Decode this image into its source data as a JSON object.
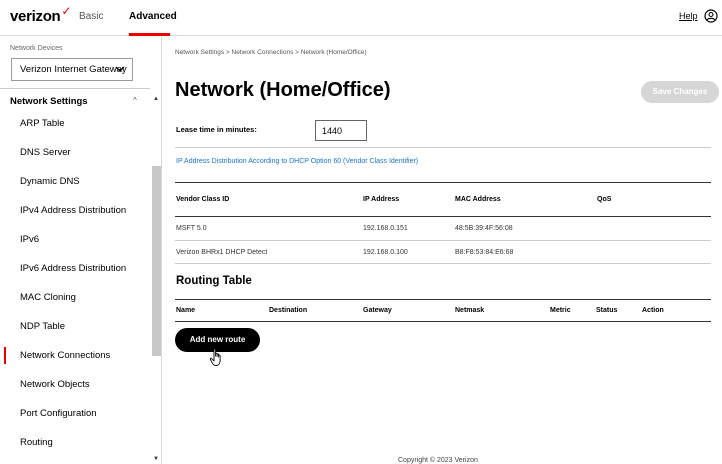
{
  "header": {
    "logo": "verizon",
    "logo_mark": "✓",
    "tabs": [
      {
        "label": "Basic"
      },
      {
        "label": "Advanced"
      }
    ],
    "help_label": "Help",
    "user_icon": "user-circle-icon",
    "accent_color": "#ee0000"
  },
  "sidebar": {
    "devices_label": "Network Devices",
    "device_selected": "Verizon Internet Gateway",
    "section_title": "Network Settings",
    "items": [
      {
        "label": "ARP Table"
      },
      {
        "label": "DNS Server"
      },
      {
        "label": "Dynamic DNS"
      },
      {
        "label": "IPv4 Address Distribution"
      },
      {
        "label": "IPv6"
      },
      {
        "label": "IPv6 Address Distribution"
      },
      {
        "label": "MAC Cloning"
      },
      {
        "label": "NDP Table"
      },
      {
        "label": "Network Connections"
      },
      {
        "label": "Network Objects"
      },
      {
        "label": "Port Configuration"
      },
      {
        "label": "Routing"
      }
    ],
    "active_item": "Network Connections"
  },
  "main": {
    "breadcrumb": "Network Settings  >  Network Connections  >  Network (Home/Office)",
    "title": "Network (Home/Office)",
    "save_label": "Save Changes",
    "lease_label": "Lease time in minutes:",
    "lease_value": "1440",
    "dhcp_link": "IP Address Distribution According to DHCP Option 60 (Vendor Class Identifier)",
    "vendor_table": {
      "headers": [
        "Vendor Class ID",
        "IP Address",
        "MAC Address",
        "QoS"
      ],
      "rows": [
        [
          "MSFT 5.0",
          "192.168.0.151",
          "48:5B:39:4F:56:08",
          ""
        ],
        [
          "Verizon BHRx1 DHCP Detect",
          "192.168.0.100",
          "B8:F8:53:84:E6:68",
          ""
        ]
      ]
    },
    "routing_title": "Routing Table",
    "routing_headers": [
      "Name",
      "Destination",
      "Gateway",
      "Netmask",
      "Metric",
      "Status",
      "Action"
    ],
    "add_route_label": "Add new route"
  },
  "footer": {
    "copyright": "Copyright © 2023 Verizon"
  }
}
